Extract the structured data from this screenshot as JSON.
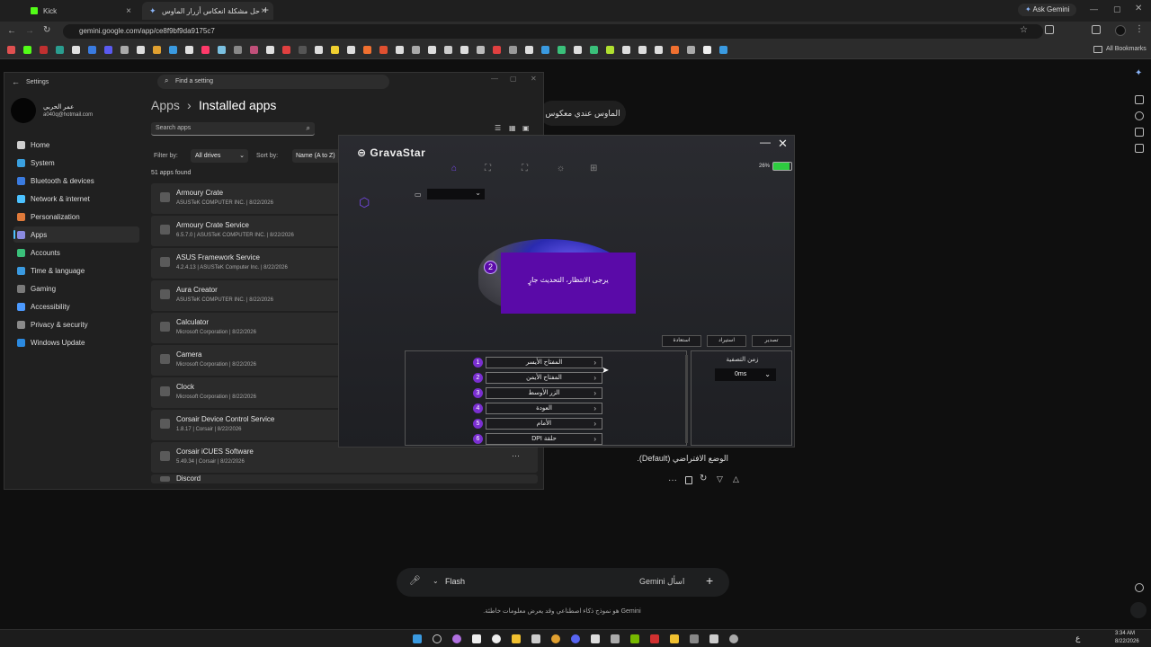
{
  "browser": {
    "tabs": [
      {
        "label": "Kick",
        "close": "×"
      },
      {
        "label": "حل مشكلة انعكاس أزرار الماوس",
        "close": "×"
      }
    ],
    "new_tab": "+",
    "ask_gemini": "Ask Gemini",
    "url": "gemini.google.com/app/ce8f9bf9da9175c7",
    "all_bookmarks": "All Bookmarks"
  },
  "gemini": {
    "user_message": "الماوس عندي معكوس",
    "response_line": "الوضع الافتراضي (Default).",
    "input_placeholder": "اسأل Gemini",
    "model": "Flash",
    "disclaimer": "Gemini هو نموذج ذكاء اصطناعي وقد يعرض معلومات خاطئة."
  },
  "settings": {
    "title": "Settings",
    "search_placeholder": "Find a setting",
    "user_name": "عمر الحربي",
    "user_email": "a040q@hotmail.com",
    "breadcrumb_parent": "Apps",
    "breadcrumb_sep": "›",
    "page_title": "Installed apps",
    "search_apps_placeholder": "Search apps",
    "filter_label": "Filter by:",
    "filter_value": "All drives",
    "sort_label": "Sort by:",
    "sort_value": "Name (A to Z)",
    "count": "51 apps found",
    "nav": [
      {
        "label": "Home",
        "color": "#cfcfcf"
      },
      {
        "label": "System",
        "color": "#3aa0e0"
      },
      {
        "label": "Bluetooth & devices",
        "color": "#3a7be0"
      },
      {
        "label": "Network & internet",
        "color": "#4cc2ff"
      },
      {
        "label": "Personalization",
        "color": "#e07a3a"
      },
      {
        "label": "Apps",
        "color": "#8a8ae0"
      },
      {
        "label": "Accounts",
        "color": "#3ac07a"
      },
      {
        "label": "Time & language",
        "color": "#3a9ae0"
      },
      {
        "label": "Gaming",
        "color": "#7a7a7a"
      },
      {
        "label": "Accessibility",
        "color": "#4c9aff"
      },
      {
        "label": "Privacy & security",
        "color": "#8a8a8a"
      },
      {
        "label": "Windows Update",
        "color": "#2b8ae0"
      }
    ],
    "apps": [
      {
        "name": "Armoury Crate",
        "meta": "ASUSTeK COMPUTER INC.  |  8/22/2026"
      },
      {
        "name": "Armoury Crate Service",
        "meta": "6.5.7.0  |  ASUSTeK COMPUTER INC.  |  8/22/2026"
      },
      {
        "name": "ASUS Framework Service",
        "meta": "4.2.4.13  |  ASUSTeK Computer Inc.  |  8/22/2026"
      },
      {
        "name": "Aura Creator",
        "meta": "ASUSTeK COMPUTER INC.  |  8/22/2026"
      },
      {
        "name": "Calculator",
        "meta": "Microsoft Corporation  |  8/22/2026"
      },
      {
        "name": "Camera",
        "meta": "Microsoft Corporation  |  8/22/2026"
      },
      {
        "name": "Clock",
        "meta": "Microsoft Corporation  |  8/22/2026"
      },
      {
        "name": "Corsair Device Control Service",
        "meta": "1.8.17  |  Corsair  |  8/22/2026"
      },
      {
        "name": "Corsair iCUES Software",
        "meta": "5.49.34  |  Corsair  |  8/22/2026"
      },
      {
        "name": "Discord",
        "meta": ""
      }
    ],
    "more": "···"
  },
  "grava": {
    "logo": "GravaStar",
    "battery": "26%",
    "loading_text": "يرجى الانتظار، التحديث جارٍ",
    "badge": "2",
    "buttons": {
      "restore": "استعادة",
      "import": "استيراد",
      "export": "تصدير"
    },
    "keys": [
      {
        "num": "1",
        "label": "المفتاح الأيسر"
      },
      {
        "num": "2",
        "label": "المفتاح الأيمن"
      },
      {
        "num": "3",
        "label": "الزر الأوسط"
      },
      {
        "num": "4",
        "label": "العودة"
      },
      {
        "num": "5",
        "label": "الأمام"
      },
      {
        "num": "6",
        "label": "DPI حلقة"
      }
    ],
    "chevron": "›",
    "debounce_label": "زمن التصفية",
    "debounce_value": "0ms",
    "min": "—",
    "close": "✕"
  },
  "taskbar": {
    "time": "3:34 AM",
    "date": "8/22/2026",
    "lang": "ع"
  }
}
